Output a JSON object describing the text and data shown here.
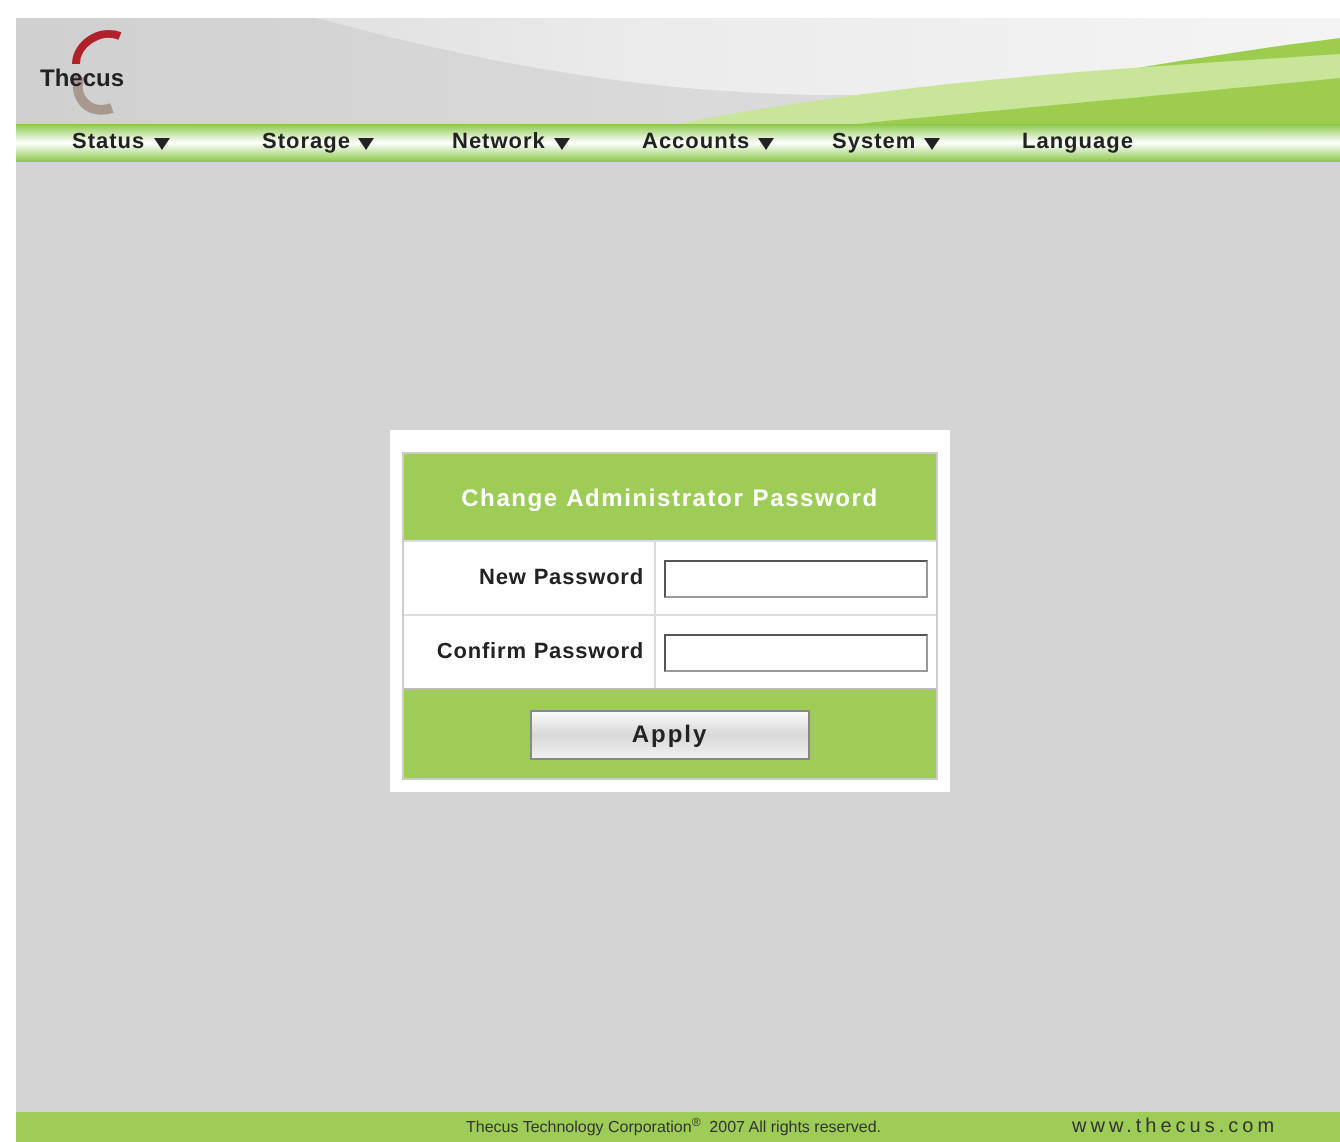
{
  "logo": {
    "text": "Thecus"
  },
  "menu": [
    {
      "label": "Status",
      "dropdown": true
    },
    {
      "label": "Storage",
      "dropdown": true
    },
    {
      "label": "Network",
      "dropdown": true
    },
    {
      "label": "Accounts",
      "dropdown": true
    },
    {
      "label": "System",
      "dropdown": true
    },
    {
      "label": "Language",
      "dropdown": false
    }
  ],
  "dialog": {
    "title": "Change Administrator Password",
    "fields": [
      {
        "label": "New Password"
      },
      {
        "label": "Confirm Password"
      }
    ],
    "button": "Apply"
  },
  "footer": {
    "copyright": "Thecus Technology Corporation$^{®}$  2007 All rights reserved.",
    "url": "www.thecus.com"
  }
}
